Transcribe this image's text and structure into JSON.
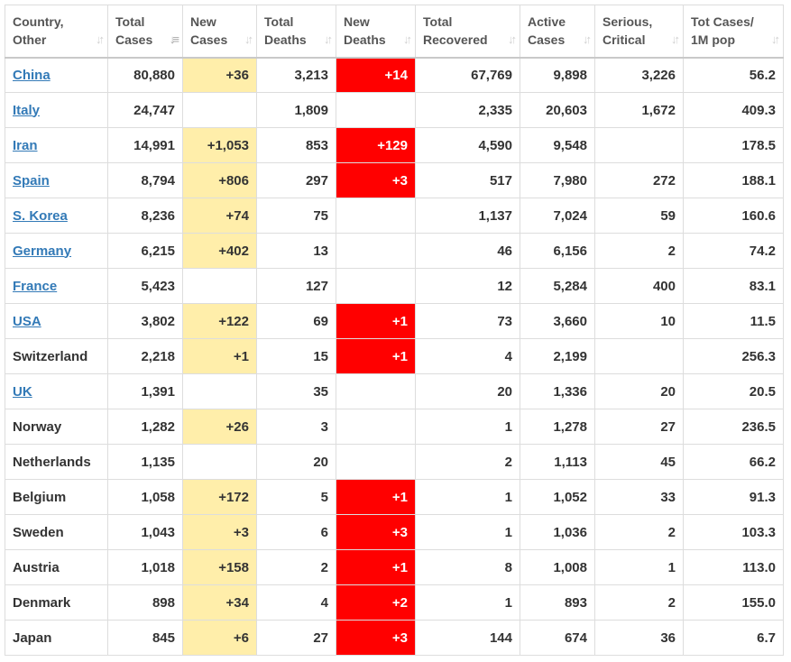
{
  "colors": {
    "link": "#337ab7",
    "new_cases_highlight": "#ffeeaa",
    "new_deaths_highlight": "#ff0000",
    "text": "#333333"
  },
  "headers": [
    {
      "line1": "Country,",
      "line2": "Other",
      "sort_icon": "sort-icon",
      "active": false
    },
    {
      "line1": "Total",
      "line2": "Cases",
      "sort_icon": "sort-desc-active-icon",
      "active": true
    },
    {
      "line1": "New",
      "line2": "Cases",
      "sort_icon": "sort-icon",
      "active": false
    },
    {
      "line1": "Total",
      "line2": "Deaths",
      "sort_icon": "sort-icon",
      "active": false
    },
    {
      "line1": "New",
      "line2": "Deaths",
      "sort_icon": "sort-icon",
      "active": false
    },
    {
      "line1": "Total",
      "line2": "Recovered",
      "sort_icon": "sort-icon",
      "active": false
    },
    {
      "line1": "Active",
      "line2": "Cases",
      "sort_icon": "sort-icon",
      "active": false
    },
    {
      "line1": "Serious,",
      "line2": "Critical",
      "sort_icon": "sort-icon",
      "active": false
    },
    {
      "line1": "Tot Cases/",
      "line2": "1M pop",
      "sort_icon": "sort-icon",
      "active": false
    }
  ],
  "rows": [
    {
      "country": "China",
      "link": true,
      "total_cases": "80,880",
      "new_cases": "+36",
      "total_deaths": "3,213",
      "new_deaths": "+14",
      "total_recovered": "67,769",
      "active_cases": "9,898",
      "serious_critical": "3,226",
      "per_million": "56.2"
    },
    {
      "country": "Italy",
      "link": true,
      "total_cases": "24,747",
      "new_cases": "",
      "total_deaths": "1,809",
      "new_deaths": "",
      "total_recovered": "2,335",
      "active_cases": "20,603",
      "serious_critical": "1,672",
      "per_million": "409.3"
    },
    {
      "country": "Iran",
      "link": true,
      "total_cases": "14,991",
      "new_cases": "+1,053",
      "total_deaths": "853",
      "new_deaths": "+129",
      "total_recovered": "4,590",
      "active_cases": "9,548",
      "serious_critical": "",
      "per_million": "178.5"
    },
    {
      "country": "Spain",
      "link": true,
      "total_cases": "8,794",
      "new_cases": "+806",
      "total_deaths": "297",
      "new_deaths": "+3",
      "total_recovered": "517",
      "active_cases": "7,980",
      "serious_critical": "272",
      "per_million": "188.1"
    },
    {
      "country": "S. Korea",
      "link": true,
      "total_cases": "8,236",
      "new_cases": "+74",
      "total_deaths": "75",
      "new_deaths": "",
      "total_recovered": "1,137",
      "active_cases": "7,024",
      "serious_critical": "59",
      "per_million": "160.6"
    },
    {
      "country": "Germany",
      "link": true,
      "total_cases": "6,215",
      "new_cases": "+402",
      "total_deaths": "13",
      "new_deaths": "",
      "total_recovered": "46",
      "active_cases": "6,156",
      "serious_critical": "2",
      "per_million": "74.2"
    },
    {
      "country": "France",
      "link": true,
      "total_cases": "5,423",
      "new_cases": "",
      "total_deaths": "127",
      "new_deaths": "",
      "total_recovered": "12",
      "active_cases": "5,284",
      "serious_critical": "400",
      "per_million": "83.1"
    },
    {
      "country": "USA",
      "link": true,
      "total_cases": "3,802",
      "new_cases": "+122",
      "total_deaths": "69",
      "new_deaths": "+1",
      "total_recovered": "73",
      "active_cases": "3,660",
      "serious_critical": "10",
      "per_million": "11.5"
    },
    {
      "country": "Switzerland",
      "link": false,
      "total_cases": "2,218",
      "new_cases": "+1",
      "total_deaths": "15",
      "new_deaths": "+1",
      "total_recovered": "4",
      "active_cases": "2,199",
      "serious_critical": "",
      "per_million": "256.3"
    },
    {
      "country": "UK",
      "link": true,
      "total_cases": "1,391",
      "new_cases": "",
      "total_deaths": "35",
      "new_deaths": "",
      "total_recovered": "20",
      "active_cases": "1,336",
      "serious_critical": "20",
      "per_million": "20.5"
    },
    {
      "country": "Norway",
      "link": false,
      "total_cases": "1,282",
      "new_cases": "+26",
      "total_deaths": "3",
      "new_deaths": "",
      "total_recovered": "1",
      "active_cases": "1,278",
      "serious_critical": "27",
      "per_million": "236.5"
    },
    {
      "country": "Netherlands",
      "link": false,
      "total_cases": "1,135",
      "new_cases": "",
      "total_deaths": "20",
      "new_deaths": "",
      "total_recovered": "2",
      "active_cases": "1,113",
      "serious_critical": "45",
      "per_million": "66.2"
    },
    {
      "country": "Belgium",
      "link": false,
      "total_cases": "1,058",
      "new_cases": "+172",
      "total_deaths": "5",
      "new_deaths": "+1",
      "total_recovered": "1",
      "active_cases": "1,052",
      "serious_critical": "33",
      "per_million": "91.3"
    },
    {
      "country": "Sweden",
      "link": false,
      "total_cases": "1,043",
      "new_cases": "+3",
      "total_deaths": "6",
      "new_deaths": "+3",
      "total_recovered": "1",
      "active_cases": "1,036",
      "serious_critical": "2",
      "per_million": "103.3"
    },
    {
      "country": "Austria",
      "link": false,
      "total_cases": "1,018",
      "new_cases": "+158",
      "total_deaths": "2",
      "new_deaths": "+1",
      "total_recovered": "8",
      "active_cases": "1,008",
      "serious_critical": "1",
      "per_million": "113.0"
    },
    {
      "country": "Denmark",
      "link": false,
      "total_cases": "898",
      "new_cases": "+34",
      "total_deaths": "4",
      "new_deaths": "+2",
      "total_recovered": "1",
      "active_cases": "893",
      "serious_critical": "2",
      "per_million": "155.0"
    },
    {
      "country": "Japan",
      "link": false,
      "total_cases": "845",
      "new_cases": "+6",
      "total_deaths": "27",
      "new_deaths": "+3",
      "total_recovered": "144",
      "active_cases": "674",
      "serious_critical": "36",
      "per_million": "6.7"
    }
  ]
}
